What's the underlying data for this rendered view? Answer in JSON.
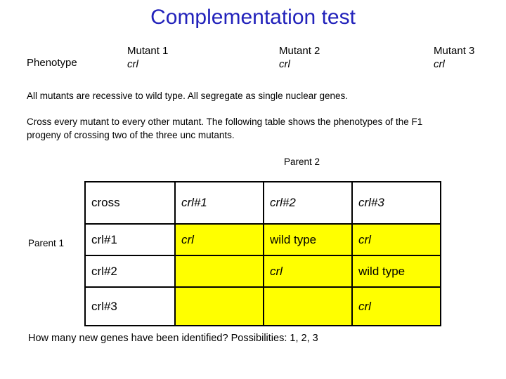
{
  "slide": {
    "title": "Complementation test",
    "title_color": "#2222bb"
  },
  "phenotype_header": {
    "label": "Phenotype",
    "mutants": [
      {
        "name": "Mutant 1",
        "phenotype": "crl"
      },
      {
        "name": "Mutant 2",
        "phenotype": "crl"
      },
      {
        "name": "Mutant 3",
        "phenotype": "crl"
      }
    ]
  },
  "paragraphs": {
    "first": "All mutants are recessive to wild type.  All segregate as single nuclear genes.",
    "second": "Cross every mutant to every other mutant. The following table shows the phenotypes of the F1 progeny of crossing two of the three unc mutants.",
    "bottom": "How many new genes have been identified? Possibilities:  1, 2, 3"
  },
  "table_axes": {
    "parent_2": "Parent 2",
    "parent_1": "Parent 1"
  },
  "cross_table": {
    "highlight_color": "#ffff00",
    "corner_label": "cross",
    "column_headers": [
      "crl#1",
      "crl#2",
      "crl#3"
    ],
    "rows": [
      {
        "label": "crl#1",
        "cells": [
          {
            "text": "crl",
            "italic": true,
            "filled": true
          },
          {
            "text": "wild type",
            "italic": false,
            "filled": true
          },
          {
            "text": "crl",
            "italic": true,
            "filled": true
          }
        ]
      },
      {
        "label": "crl#2",
        "cells": [
          {
            "text": "",
            "italic": false,
            "filled": true
          },
          {
            "text": "crl",
            "italic": true,
            "filled": true
          },
          {
            "text": "wild type",
            "italic": false,
            "filled": true
          }
        ]
      },
      {
        "label": "crl#3",
        "cells": [
          {
            "text": "",
            "italic": false,
            "filled": true
          },
          {
            "text": "",
            "italic": false,
            "filled": true
          },
          {
            "text": "crl",
            "italic": true,
            "filled": true
          }
        ]
      }
    ]
  }
}
